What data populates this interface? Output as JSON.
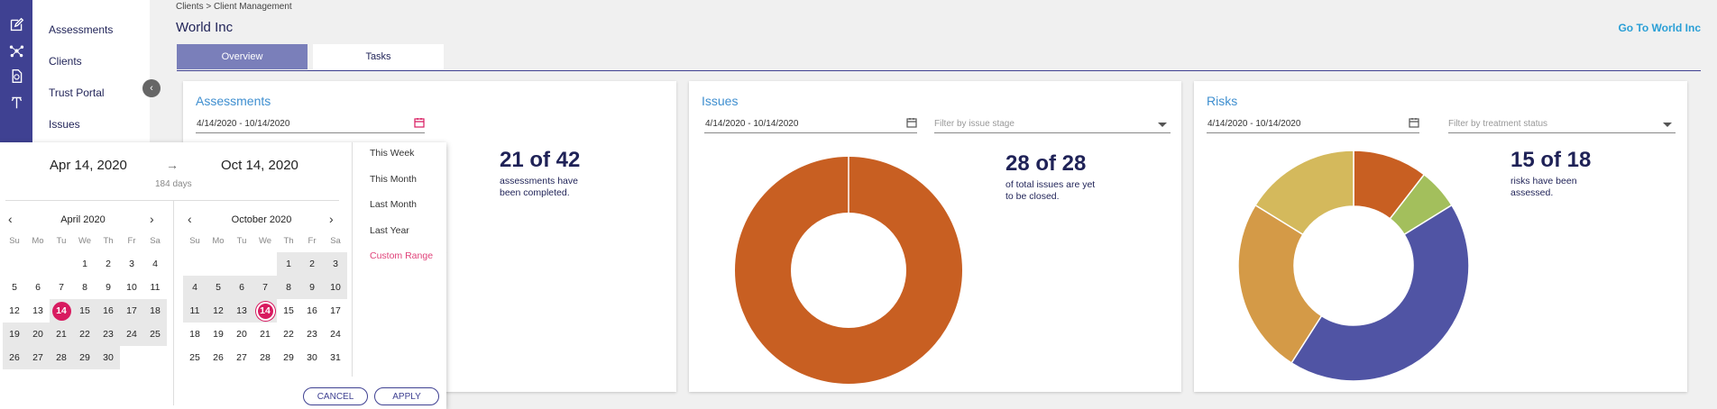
{
  "nav": {
    "items": [
      {
        "label": "Assessments",
        "icon": "edit-icon"
      },
      {
        "label": "Clients",
        "icon": "network-icon"
      },
      {
        "label": "Trust Portal",
        "icon": "portal-icon"
      },
      {
        "label": "Issues",
        "icon": "tools-icon"
      }
    ],
    "collapse_icon": "chevron-left-icon"
  },
  "header": {
    "breadcrumb": "Clients >  Client Management",
    "title": "World Inc",
    "go_link": "Go To World Inc",
    "tabs": [
      {
        "label": "Overview",
        "active": true
      },
      {
        "label": "Tasks",
        "active": false
      }
    ]
  },
  "cards": {
    "assessments": {
      "title": "Assessments",
      "date_range": "4/14/2020 - 10/14/2020",
      "stat": "21 of 42",
      "caption_1": "assessments have",
      "caption_2": "been completed."
    },
    "issues": {
      "title": "Issues",
      "date_range": "4/14/2020 - 10/14/2020",
      "filter_placeholder": "Filter by issue stage",
      "stat": "28 of 28",
      "caption_1": "of total issues are yet",
      "caption_2": "to be closed."
    },
    "risks": {
      "title": "Risks",
      "date_range": "4/14/2020 - 10/14/2020",
      "filter_placeholder": "Filter by treatment status",
      "stat": "15 of 18",
      "caption_1": "risks have been",
      "caption_2": "assessed."
    }
  },
  "picker": {
    "from": "Apr 14, 2020",
    "to": "Oct 14, 2020",
    "days": "184 days",
    "weekdays": [
      "Su",
      "Mo",
      "Tu",
      "We",
      "Th",
      "Fr",
      "Sa"
    ],
    "left_month": "April 2020",
    "right_month": "October 2020",
    "presets": [
      "This Week",
      "This Month",
      "Last Month",
      "Last Year",
      "Custom Range"
    ],
    "active_preset": 4,
    "cancel": "CANCEL",
    "apply": "APPLY"
  },
  "colors": {
    "accent": "#3f4192",
    "selected_day": "#d81b60",
    "issues_donut": "#c85f22",
    "risk_segments": [
      "#c85f22",
      "#a3bf5c",
      "#5054a4",
      "#d49a47",
      "#d4b95c"
    ]
  },
  "risk_segment_values": [
    11,
    6,
    45,
    26,
    17
  ]
}
